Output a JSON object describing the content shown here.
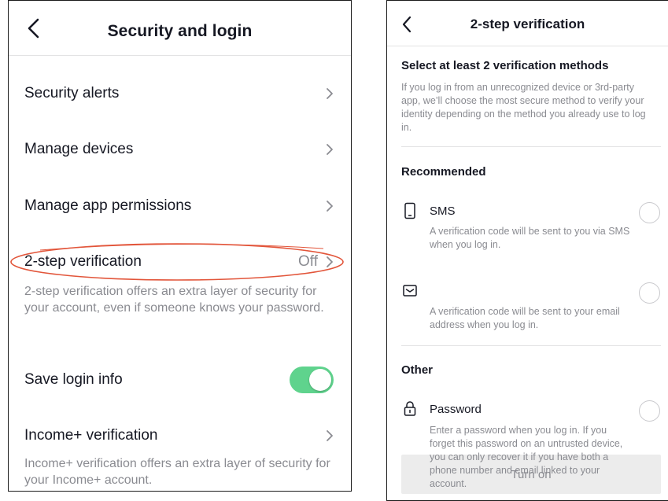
{
  "left": {
    "title": "Security and login",
    "rows": [
      {
        "label": "Security alerts"
      },
      {
        "label": "Manage devices"
      },
      {
        "label": "Manage app permissions"
      },
      {
        "label": "2-step verification",
        "value": "Off",
        "description": "2-step verification offers an extra layer of security for your account, even if someone knows your password."
      },
      {
        "label": "Save login info",
        "toggle_on": true
      },
      {
        "label": "Income+ verification",
        "description": "Income+ verification offers an extra layer of security for your Income+ account."
      }
    ],
    "highlight_color": "#e2553a",
    "toggle_color": "#5fd38d"
  },
  "right": {
    "title": "2-step verification",
    "heading": "Select at least 2 verification methods",
    "intro": "If you log in from an unrecognized device or 3rd-party app, we’ll choose the most secure method to verify your identity depending on the method you already use to log in.",
    "recommended_label": "Recommended",
    "other_label": "Other",
    "methods": [
      {
        "name": "SMS",
        "icon": "phone-icon",
        "description": "A verification code will be sent to you via SMS when you log in."
      },
      {
        "name": "",
        "icon": "email-icon",
        "description": "A verification code will be sent to your email address when you log in."
      },
      {
        "name": "Password",
        "icon": "lock-icon",
        "description": "Enter a password when you log in. If you forget this password on an untrusted device, you can only recover it if you have both a phone number and email linked to your account."
      }
    ],
    "button_label": "Turn on"
  }
}
